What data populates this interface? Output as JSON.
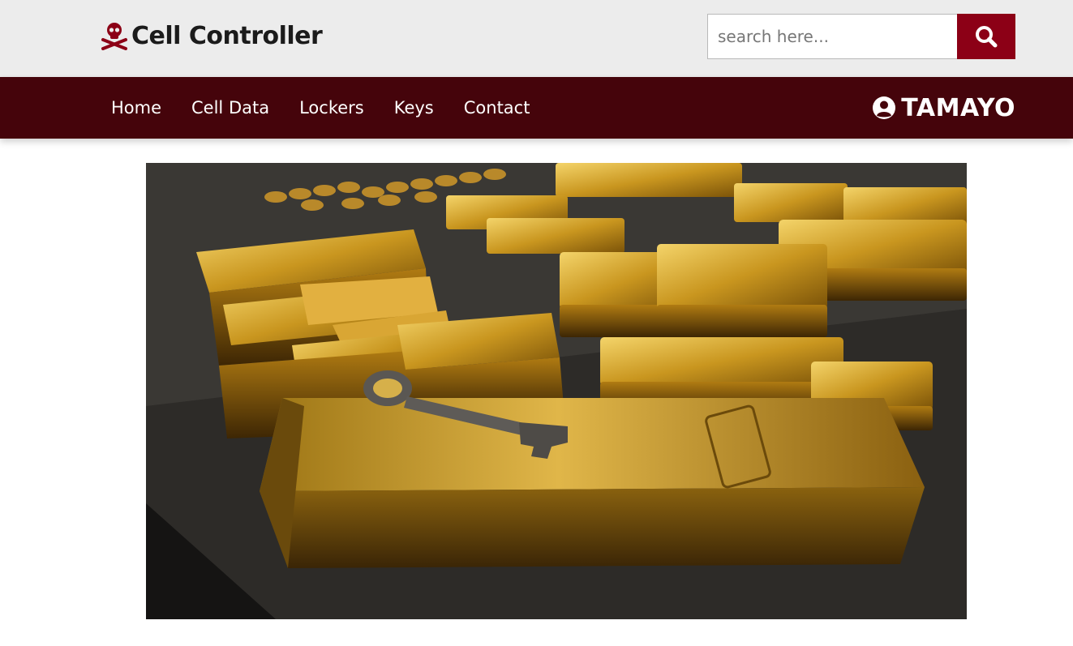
{
  "header": {
    "brand_title": "Cell Controller",
    "brand_icon": "skull-crossbones-icon",
    "search": {
      "placeholder": "search here...",
      "button_icon": "search-icon"
    }
  },
  "nav": {
    "items": [
      {
        "label": "Home"
      },
      {
        "label": "Cell Data"
      },
      {
        "label": "Lockers"
      },
      {
        "label": "Keys"
      },
      {
        "label": "Contact"
      }
    ],
    "user": {
      "icon": "user-circle-icon",
      "name": "TAMAYO"
    }
  },
  "hero": {
    "description": "gold bars with a key"
  },
  "colors": {
    "topbar_bg": "#ececec",
    "navbar_bg": "#45040b",
    "accent": "#8c0016",
    "brand_text": "#1b1b1b"
  }
}
